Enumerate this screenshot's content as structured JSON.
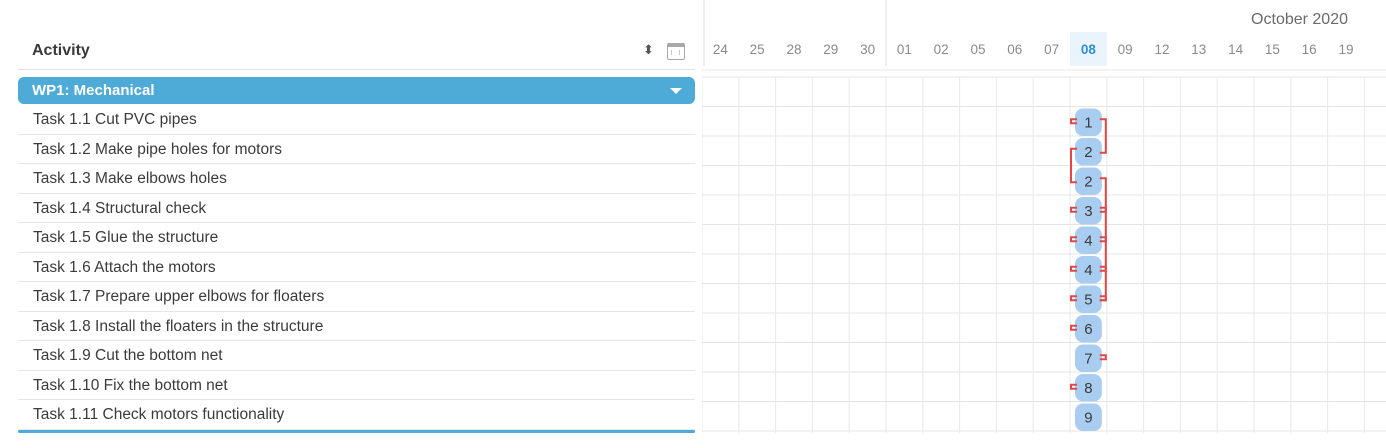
{
  "header": {
    "activity_label": "Activity",
    "sort_icon": "sort-icon",
    "calendar_icon": "calendar-icon",
    "month_label": "October 2020"
  },
  "timeline": {
    "dates": [
      "24",
      "25",
      "28",
      "29",
      "30",
      "01",
      "02",
      "05",
      "06",
      "07",
      "08",
      "09",
      "12",
      "13",
      "14",
      "15",
      "16",
      "19"
    ],
    "today": "08"
  },
  "work_package": {
    "label": "WP1: Mechanical",
    "caret_icon": "caret-down-icon",
    "color": "#4eaad6"
  },
  "tasks": [
    {
      "label": "Task 1.1 Cut PVC pipes",
      "badge": "1"
    },
    {
      "label": "Task 1.2 Make pipe holes for motors",
      "badge": "2"
    },
    {
      "label": "Task 1.3 Make elbows holes",
      "badge": "2"
    },
    {
      "label": "Task 1.4 Structural check",
      "badge": "3"
    },
    {
      "label": "Task 1.5 Glue the structure",
      "badge": "4"
    },
    {
      "label": "Task 1.6 Attach the motors",
      "badge": "4"
    },
    {
      "label": "Task 1.7 Prepare upper elbows for floaters",
      "badge": "5"
    },
    {
      "label": "Task 1.8 Install the floaters in the structure",
      "badge": "6"
    },
    {
      "label": "Task 1.9 Cut the bottom net",
      "badge": "7"
    },
    {
      "label": "Task 1.10 Fix the bottom net",
      "badge": "8"
    },
    {
      "label": "Task 1.11 Check motors functionality",
      "badge": "9"
    }
  ],
  "colors": {
    "accent": "#4eaad6",
    "pill": "#a9cdf0",
    "dependency": "#e04848",
    "today": "#2f8fd0"
  }
}
